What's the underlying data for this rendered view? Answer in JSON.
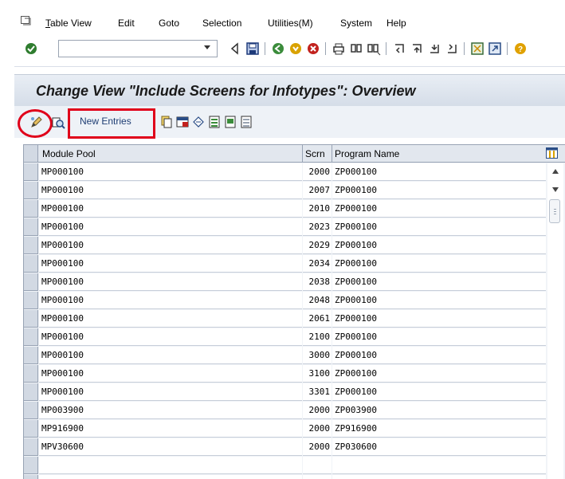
{
  "menubar": {
    "items": [
      "Table View",
      "Edit",
      "Goto",
      "Selection",
      "Utilities(M)",
      "System",
      "Help"
    ]
  },
  "toolbar": {
    "command_field_value": "",
    "icons": [
      "enter-icon",
      "back-icon",
      "save-icon",
      "back-green-icon",
      "exit-icon",
      "cancel-icon",
      "print-icon",
      "find-icon",
      "find-next-icon",
      "first-page-icon",
      "previous-page-icon",
      "next-page-icon",
      "last-page-icon",
      "create-session-icon",
      "shortcut-icon",
      "help-icon"
    ]
  },
  "title": "Change View \"Include Screens for Infotypes\": Overview",
  "app_toolbar": {
    "new_entries_label": "New Entries",
    "icons": [
      "display-change-icon",
      "details-icon",
      "copy-icon",
      "delete-icon",
      "undo-icon",
      "select-all-icon",
      "select-block-icon",
      "deselect-all-icon"
    ]
  },
  "table": {
    "columns": [
      "Module Pool",
      "Scrn",
      "Program Name"
    ],
    "rows": [
      {
        "pool": "MP000100",
        "scrn": "2000",
        "prog": "ZP000100"
      },
      {
        "pool": "MP000100",
        "scrn": "2007",
        "prog": "ZP000100"
      },
      {
        "pool": "MP000100",
        "scrn": "2010",
        "prog": "ZP000100"
      },
      {
        "pool": "MP000100",
        "scrn": "2023",
        "prog": "ZP000100"
      },
      {
        "pool": "MP000100",
        "scrn": "2029",
        "prog": "ZP000100"
      },
      {
        "pool": "MP000100",
        "scrn": "2034",
        "prog": "ZP000100"
      },
      {
        "pool": "MP000100",
        "scrn": "2038",
        "prog": "ZP000100"
      },
      {
        "pool": "MP000100",
        "scrn": "2048",
        "prog": "ZP000100"
      },
      {
        "pool": "MP000100",
        "scrn": "2061",
        "prog": "ZP000100"
      },
      {
        "pool": "MP000100",
        "scrn": "2100",
        "prog": "ZP000100"
      },
      {
        "pool": "MP000100",
        "scrn": "3000",
        "prog": "ZP000100"
      },
      {
        "pool": "MP000100",
        "scrn": "3100",
        "prog": "ZP000100"
      },
      {
        "pool": "MP000100",
        "scrn": "3301",
        "prog": "ZP000100"
      },
      {
        "pool": "MP003900",
        "scrn": "2000",
        "prog": "ZP003900"
      },
      {
        "pool": "MP916900",
        "scrn": "2000",
        "prog": "ZP916900"
      },
      {
        "pool": "MPV30600",
        "scrn": "2000",
        "prog": "ZP030600"
      },
      {
        "pool": "",
        "scrn": "",
        "prog": ""
      },
      {
        "pool": "",
        "scrn": "",
        "prog": ""
      }
    ]
  },
  "colors": {
    "annotation_red": "#e0001a",
    "title_gradient_top": "#e9eef5",
    "title_gradient_bottom": "#d5dde8"
  }
}
